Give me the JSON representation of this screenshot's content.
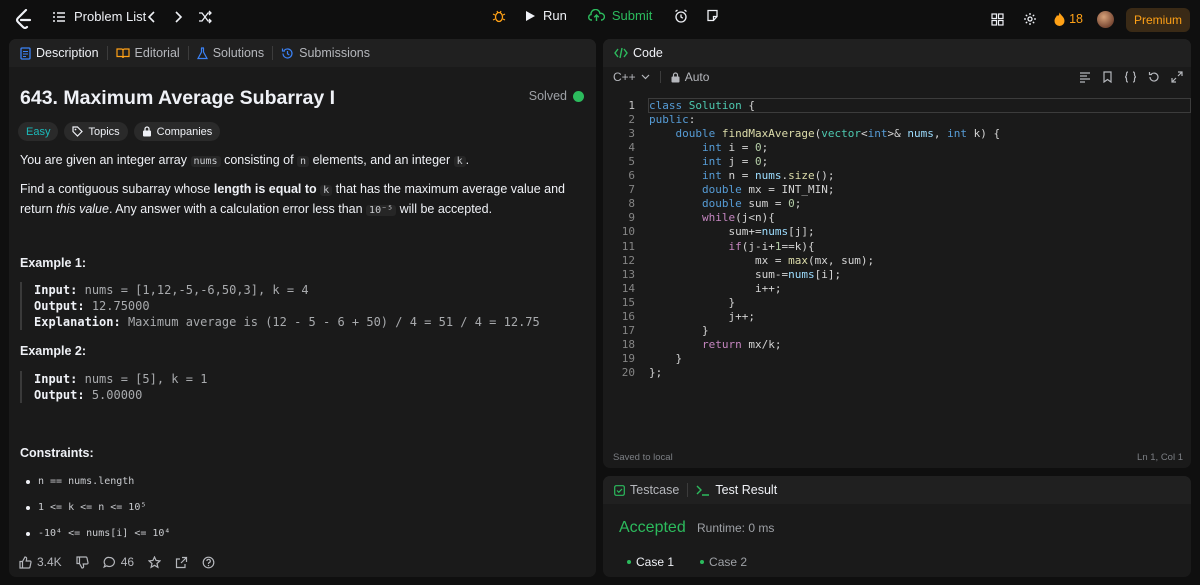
{
  "topbar": {
    "problem_list": "Problem List",
    "run_label": "Run",
    "submit_label": "Submit",
    "streak": "18",
    "premium_label": "Premium"
  },
  "left": {
    "tabs": [
      "Description",
      "Editorial",
      "Solutions",
      "Submissions"
    ],
    "title": "643. Maximum Average Subarray I",
    "solved_label": "Solved",
    "difficulty": "Easy",
    "topics_label": "Topics",
    "companies_label": "Companies",
    "p1": {
      "a": "You are given an integer array",
      "nums": "nums",
      "b": "consisting of",
      "n": "n",
      "c": "elements, and an integer",
      "k": "k",
      "d": "."
    },
    "p2": {
      "a": "Find a contiguous subarray whose",
      "bold": "length is equal to",
      "k": "k",
      "b": "that has the maximum average value and return",
      "italic": "this value",
      "c": ". Any answer with a calculation error less than",
      "err": "10⁻⁵",
      "d": "will be accepted."
    },
    "example1": {
      "heading": "Example 1:",
      "input_label": "Input:",
      "input": "nums = [1,12,-5,-6,50,3], k = 4",
      "output_label": "Output:",
      "output": "12.75000",
      "explanation_label": "Explanation:",
      "explanation": "Maximum average is (12 - 5 - 6 + 50) / 4 = 51 / 4 = 12.75"
    },
    "example2": {
      "heading": "Example 2:",
      "input_label": "Input:",
      "input": "nums = [5], k = 1",
      "output_label": "Output:",
      "output": "5.00000"
    },
    "constraints_heading": "Constraints:",
    "constraints": [
      "n == nums.length",
      "1 <= k <= n <= 10⁵",
      "-10⁴ <= nums[i] <= 10⁴"
    ],
    "likes": "3.4K",
    "comments": "46"
  },
  "code": {
    "tab_label": "Code",
    "language": "C++",
    "mode": "Auto",
    "saved": "Saved to local",
    "position": "Ln 1, Col 1",
    "lines": [
      "class Solution {",
      "public:",
      "    double findMaxAverage(vector<int>& nums, int k) {",
      "        int i = 0;",
      "        int j = 0;",
      "        int n = nums.size();",
      "        double mx = INT_MIN;",
      "        double sum = 0;",
      "        while(j<n){",
      "            sum+=nums[j];",
      "            if(j-i+1==k){",
      "                mx = max(mx, sum);",
      "                sum-=nums[i];",
      "                i++;",
      "            }",
      "            j++;",
      "        }",
      "        return mx/k;",
      "    }",
      "};"
    ]
  },
  "result": {
    "tabs": [
      "Testcase",
      "Test Result"
    ],
    "status": "Accepted",
    "runtime": "Runtime: 0 ms",
    "cases": [
      "Case 1",
      "Case 2"
    ]
  },
  "colors": {
    "accent_green": "#2cbb5d",
    "premium_orange": "#ffa116",
    "easy_teal": "#1cbaba",
    "panel_bg": "#1a1a1a"
  }
}
